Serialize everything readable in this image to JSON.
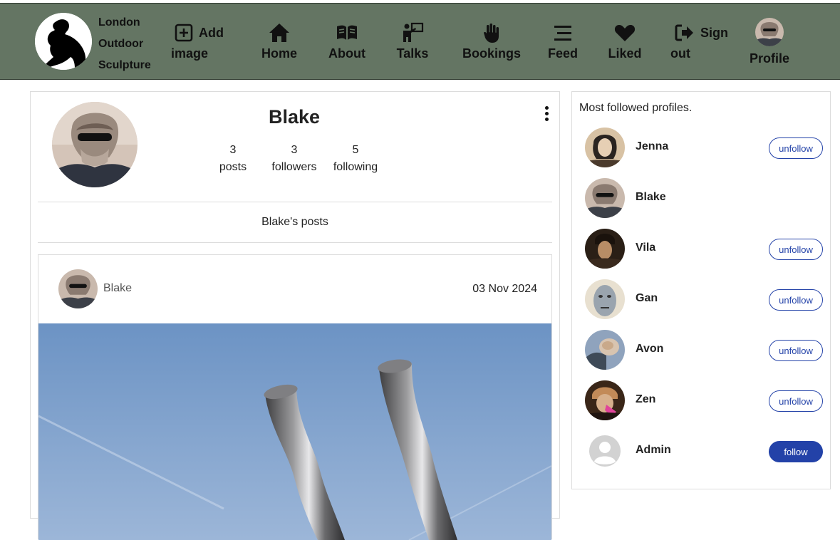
{
  "brand": {
    "line1": "London",
    "line2": "Outdoor",
    "line3": "Sculpture"
  },
  "nav": {
    "add_image": {
      "line1": "Add",
      "line2": "image",
      "icon": "plus-square-icon"
    },
    "home": {
      "label": "Home",
      "icon": "home-icon"
    },
    "about": {
      "label": "About",
      "icon": "book-icon"
    },
    "talks": {
      "label": "Talks",
      "icon": "presenter-icon"
    },
    "bookings": {
      "label": "Bookings",
      "icon": "hand-icon"
    },
    "feed": {
      "label": "Feed",
      "icon": "stream-icon"
    },
    "liked": {
      "label": "Liked",
      "icon": "heart-icon"
    },
    "sign_out": {
      "line1": "Sign",
      "line2": "out",
      "icon": "sign-out-icon"
    },
    "profile": {
      "label": "Profile"
    }
  },
  "profile": {
    "name": "Blake",
    "stats": [
      {
        "value": "3",
        "label": "posts"
      },
      {
        "value": "3",
        "label": "followers"
      },
      {
        "value": "5",
        "label": "following"
      }
    ],
    "posts_title": "Blake's posts"
  },
  "post": {
    "author": "Blake",
    "date": "03 Nov 2024"
  },
  "sidebar": {
    "title": "Most followed profiles.",
    "profiles": [
      {
        "name": "Jenna",
        "button": "unfollow"
      },
      {
        "name": "Blake",
        "button": ""
      },
      {
        "name": "Vila",
        "button": "unfollow"
      },
      {
        "name": "Gan",
        "button": "unfollow"
      },
      {
        "name": "Avon",
        "button": "unfollow"
      },
      {
        "name": "Zen",
        "button": "unfollow"
      },
      {
        "name": "Admin",
        "button": "follow"
      }
    ]
  },
  "colors": {
    "navbar": "#647563",
    "accent": "#2342a8"
  }
}
